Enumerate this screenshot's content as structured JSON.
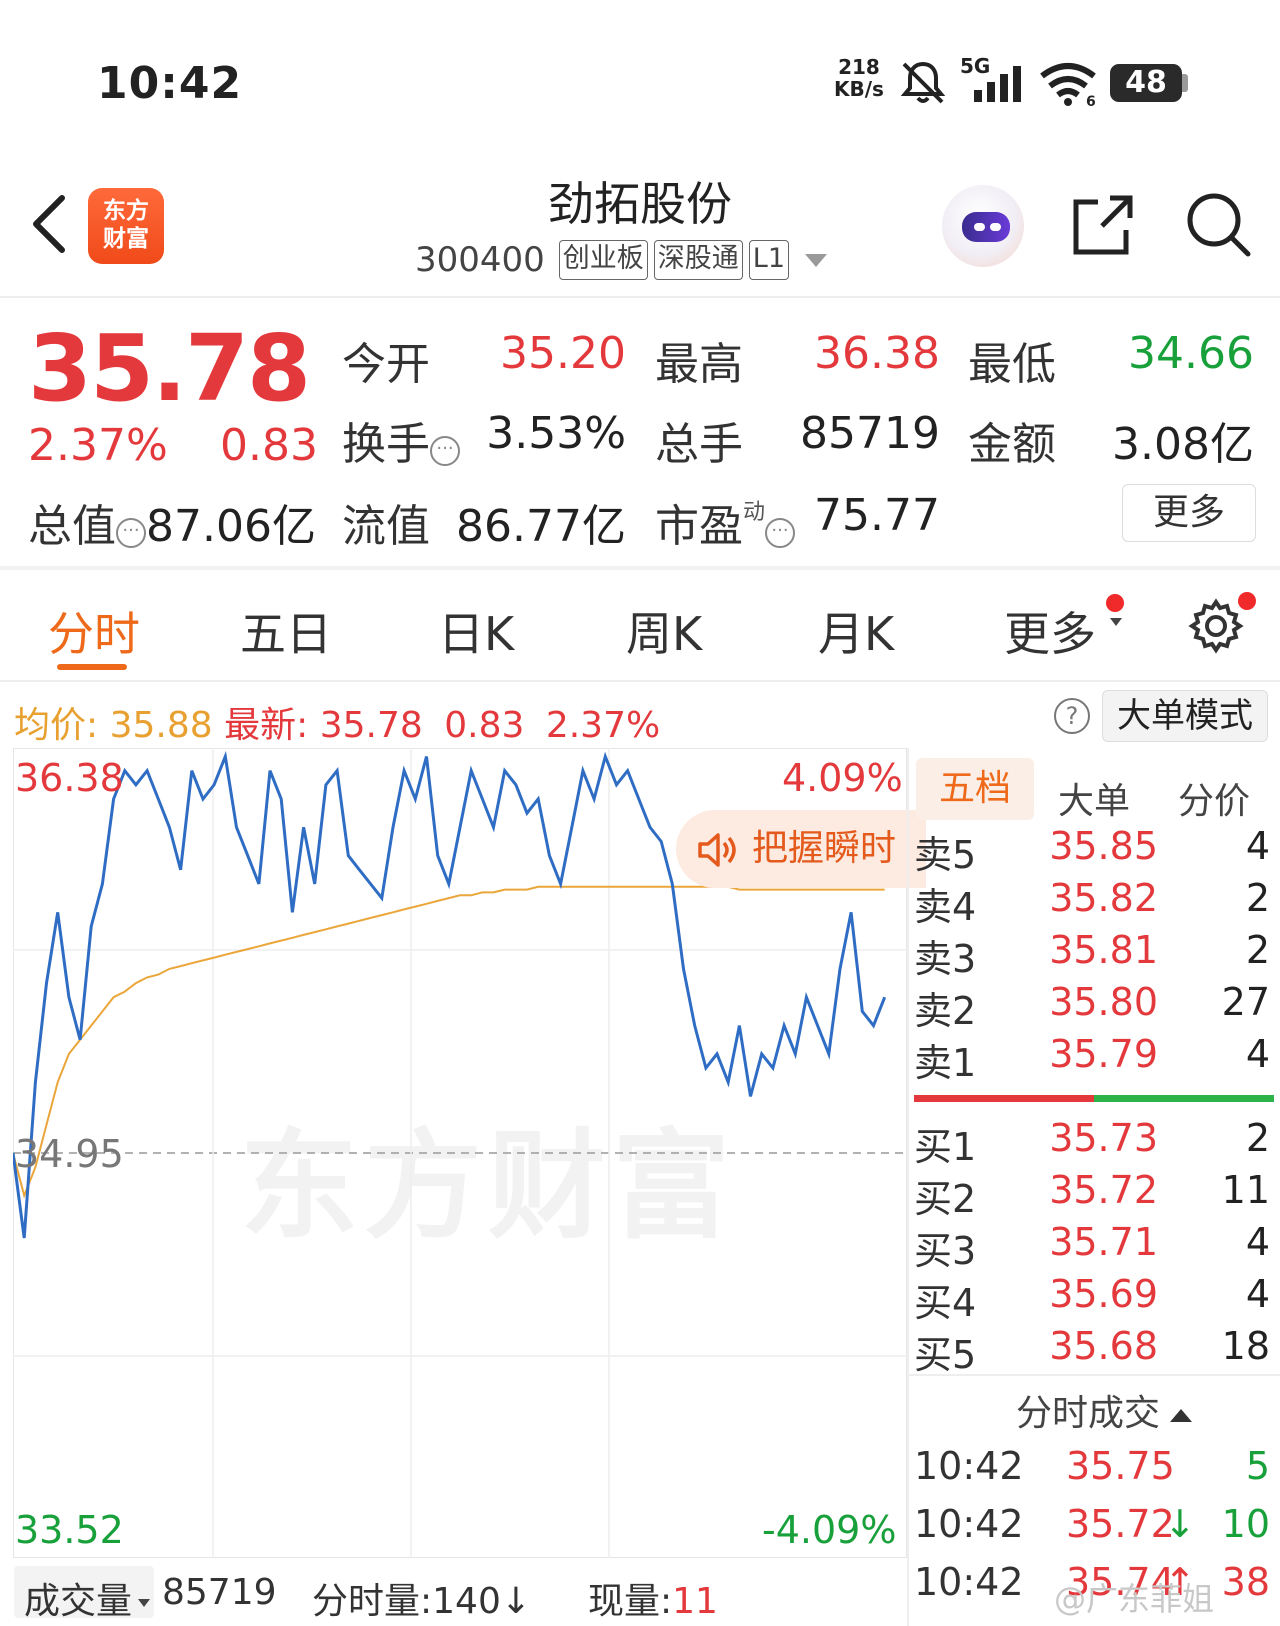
{
  "status_bar": {
    "time": "10:42",
    "net_speed_value": "218",
    "net_speed_unit": "KB/s",
    "network": "5G",
    "battery": "48",
    "icons": [
      "mute-bell-icon",
      "signal-icon",
      "wifi-icon",
      "battery-icon"
    ]
  },
  "header": {
    "logo_line1": "东方",
    "logo_line2": "财富",
    "stock_name": "劲拓股份",
    "stock_code": "300400",
    "tags": [
      "创业板",
      "深股通",
      "L1"
    ]
  },
  "quote": {
    "price": "35.78",
    "change_pct": "2.37%",
    "change": "0.83",
    "open_label": "今开",
    "open": "35.20",
    "high_label": "最高",
    "high": "36.38",
    "low_label": "最低",
    "low": "34.66",
    "turnover_label": "换手",
    "turnover": "3.53%",
    "volume_label": "总手",
    "volume": "85719",
    "amount_label": "金额",
    "amount": "3.08亿",
    "mktcap_label": "总值",
    "mktcap": "87.06亿",
    "float_label": "流值",
    "float_cap": "86.77亿",
    "pe_label": "市盈",
    "pe_sup": "动",
    "pe": "75.77",
    "more": "更多"
  },
  "tabs": [
    "分时",
    "五日",
    "日K",
    "周K",
    "月K",
    "更多"
  ],
  "info_line": {
    "avg_label": "均价:",
    "avg": "35.88",
    "latest_label": "最新:",
    "latest": "35.78",
    "change": "0.83",
    "pct": "2.37%",
    "mode_button": "大单模式"
  },
  "chart_data": {
    "type": "line",
    "ylim": [
      33.52,
      36.38
    ],
    "y_left_labels": {
      "top": "36.38",
      "mid": "34.95",
      "bottom": "33.52"
    },
    "y_right_labels": {
      "top": "4.09%",
      "bottom": "-4.09%"
    },
    "prev_close": 34.95,
    "session_minutes": 240,
    "price_series": [
      34.95,
      34.65,
      35.2,
      35.55,
      35.8,
      35.5,
      35.35,
      35.75,
      35.9,
      36.2,
      36.3,
      36.25,
      36.3,
      36.2,
      36.1,
      35.95,
      36.3,
      36.2,
      36.25,
      36.35,
      36.1,
      36.0,
      35.9,
      36.3,
      36.2,
      35.8,
      36.1,
      35.9,
      36.25,
      36.3,
      36.0,
      35.95,
      35.9,
      35.85,
      36.1,
      36.3,
      36.2,
      36.35,
      36.0,
      35.9,
      36.1,
      36.3,
      36.2,
      36.1,
      36.3,
      36.25,
      36.15,
      36.2,
      36.0,
      35.9,
      36.1,
      36.3,
      36.2,
      36.35,
      36.25,
      36.3,
      36.2,
      36.1,
      36.05,
      35.9,
      35.6,
      35.4,
      35.25,
      35.3,
      35.2,
      35.4,
      35.15,
      35.3,
      35.25,
      35.4,
      35.3,
      35.5,
      35.4,
      35.3,
      35.6,
      35.8,
      35.45,
      35.4,
      35.5
    ],
    "avg_series": [
      34.95,
      34.8,
      34.9,
      35.05,
      35.2,
      35.3,
      35.35,
      35.4,
      35.45,
      35.5,
      35.52,
      35.55,
      35.57,
      35.58,
      35.6,
      35.61,
      35.62,
      35.63,
      35.64,
      35.65,
      35.66,
      35.67,
      35.68,
      35.69,
      35.7,
      35.71,
      35.72,
      35.73,
      35.74,
      35.75,
      35.76,
      35.77,
      35.78,
      35.79,
      35.8,
      35.81,
      35.82,
      35.83,
      35.84,
      35.85,
      35.86,
      35.86,
      35.87,
      35.87,
      35.88,
      35.88,
      35.88,
      35.89,
      35.89,
      35.89,
      35.89,
      35.89,
      35.89,
      35.89,
      35.89,
      35.89,
      35.89,
      35.89,
      35.89,
      35.89,
      35.89,
      35.89,
      35.89,
      35.89,
      35.89,
      35.88,
      35.88,
      35.88,
      35.88,
      35.88,
      35.88,
      35.88,
      35.88,
      35.88,
      35.88,
      35.88,
      35.88,
      35.88,
      35.88
    ]
  },
  "watermark": "东方财富",
  "grasp_banner": "把握瞬时",
  "order_book": {
    "tabs": [
      "五档",
      "大单",
      "分价"
    ],
    "asks": [
      {
        "label": "卖5",
        "price": "35.85",
        "vol": "4"
      },
      {
        "label": "卖4",
        "price": "35.82",
        "vol": "2"
      },
      {
        "label": "卖3",
        "price": "35.81",
        "vol": "2"
      },
      {
        "label": "卖2",
        "price": "35.80",
        "vol": "27"
      },
      {
        "label": "卖1",
        "price": "35.79",
        "vol": "4"
      }
    ],
    "bids": [
      {
        "label": "买1",
        "price": "35.73",
        "vol": "2"
      },
      {
        "label": "买2",
        "price": "35.72",
        "vol": "11"
      },
      {
        "label": "买3",
        "price": "35.71",
        "vol": "4"
      },
      {
        "label": "买4",
        "price": "35.69",
        "vol": "4"
      },
      {
        "label": "买5",
        "price": "35.68",
        "vol": "18"
      }
    ],
    "bar_red_fraction": 0.5,
    "ticks_title": "分时成交",
    "ticks": [
      {
        "time": "10:42",
        "price": "35.75",
        "arrow": "",
        "vol": "5",
        "dir": "green"
      },
      {
        "time": "10:42",
        "price": "35.72",
        "arrow": "↓",
        "vol": "10",
        "dir": "green"
      },
      {
        "time": "10:42",
        "price": "35.74",
        "arrow": "↑",
        "vol": "38",
        "dir": "red"
      }
    ]
  },
  "bottom": {
    "vol_label": "成交量",
    "vol_value": "85719",
    "tick_vol": "分时量:140",
    "tick_arrow": "↓",
    "now_label": "现量:",
    "now_value": "11",
    "signature": "@广东菲姐"
  }
}
